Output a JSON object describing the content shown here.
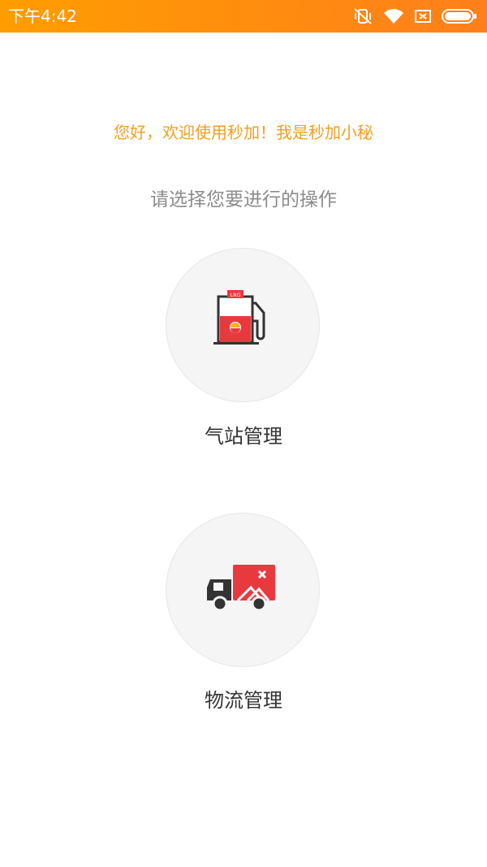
{
  "status_bar": {
    "time": "下午4:42",
    "icons": [
      "vibrate-off-icon",
      "wifi-icon",
      "sim-missing-icon",
      "battery-icon"
    ],
    "background": "#ff8c0f"
  },
  "greeting": "您好，欢迎使用秒加！我是秒加小秘",
  "prompt": "请选择您要进行的操作",
  "options": [
    {
      "label": "气站管理",
      "icon": "gas-pump-icon",
      "badge": "LNG"
    },
    {
      "label": "物流管理",
      "icon": "truck-icon"
    }
  ],
  "colors": {
    "greeting": "#f0a020",
    "prompt": "#8c8c8c",
    "icon_red": "#e8393f",
    "icon_dark": "#333333"
  }
}
